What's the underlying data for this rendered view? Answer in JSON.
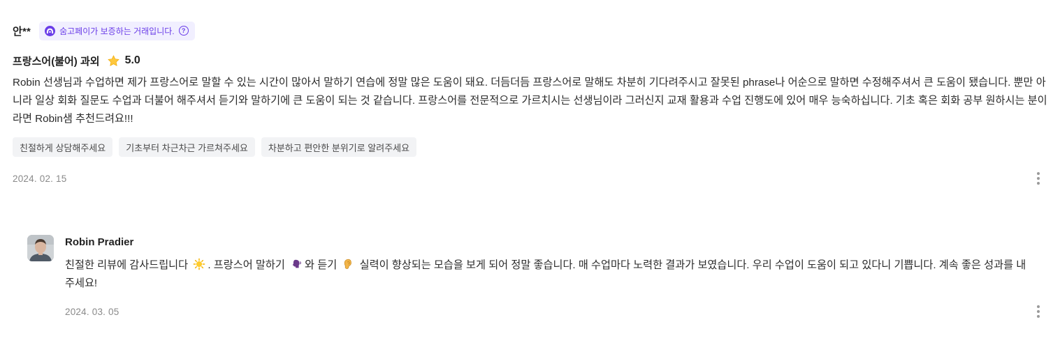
{
  "review": {
    "reviewer_name": "안**",
    "badge_text": "숨고페이가 보증하는 거래입니다.",
    "service_name": "프랑스어(불어) 과외",
    "rating": "5.0",
    "text": "Robin 선생님과 수업하면 제가 프랑스어로 말할 수 있는 시간이 많아서 말하기 연습에 정말 많은 도움이 돼요. 더듬더듬 프랑스어로 말해도 차분히 기다려주시고 잘못된 phrase나 어순으로 말하면 수정해주셔서 큰 도움이 됐습니다. 뿐만 아니라 일상 회화 질문도 수업과 더불어 해주셔서 듣기와 말하기에 큰 도움이 되는 것 같습니다. 프랑스어를 전문적으로 가르치시는 선생님이라 그러신지 교재 활용과 수업 진행도에 있어 매우 능숙하십니다. 기초 혹은 회화 공부 원하시는 분이라면 Robin샘 추천드려요!!!",
    "tags": [
      "친절하게 상담해주세요",
      "기초부터 차근차근 가르쳐주세요",
      "차분하고 편안한 분위기로 알려주세요"
    ],
    "date": "2024. 02. 15"
  },
  "reply": {
    "name": "Robin Pradier",
    "text_part1": "친절한 리뷰에 감사드립니다",
    "text_part2": ". 프랑스어 말하기",
    "text_part3": "와 듣기",
    "text_part4": "실력이 향상되는 모습을 보게 되어 정말 좋습니다. 매 수업마다 노력한 결과가 보였습니다. 우리 수업이 도움이 되고 있다니 기쁩니다. 계속 좋은 성과를 내주세요!",
    "date": "2024. 03. 05"
  },
  "icons": {
    "badge_logo": "soomgo-pay-logo-icon",
    "help": "question-circle-icon",
    "star": "star-icon",
    "more": "more-vertical-icon",
    "sun": "sun-emoji-icon",
    "speaking": "speaking-head-emoji-icon",
    "ear": "ear-emoji-icon"
  },
  "colors": {
    "accent": "#6a3de8",
    "badge_bg": "#f1efff",
    "star": "#ffc83d",
    "tag_bg": "#f2f3f5",
    "date": "#8a8a8a"
  }
}
